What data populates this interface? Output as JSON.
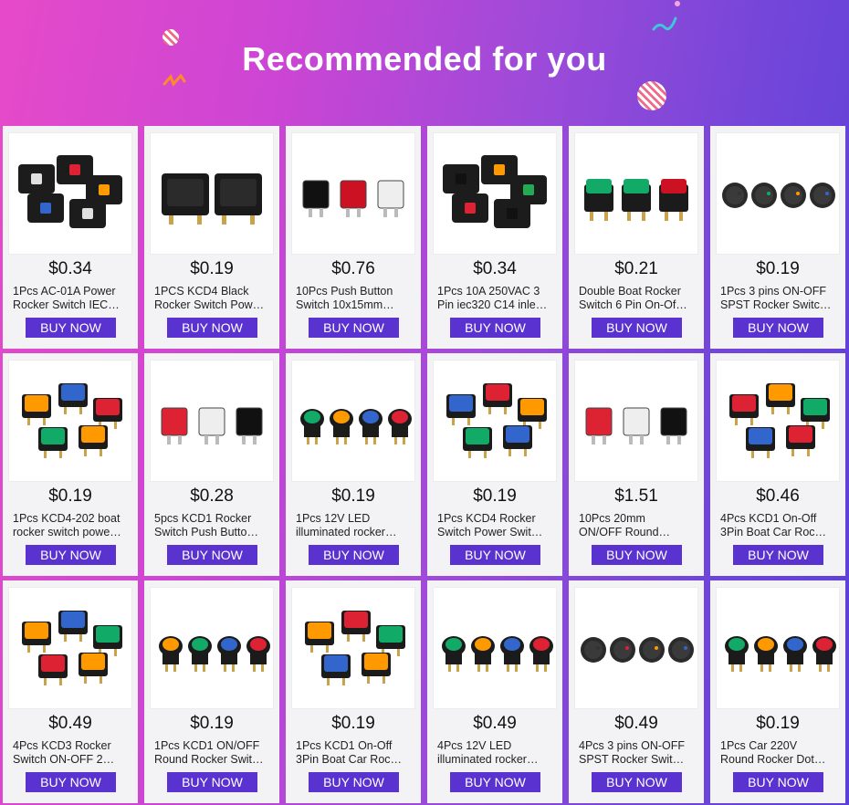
{
  "header": {
    "title": "Recommended for you",
    "accent_color": "#5a32d0"
  },
  "products": [
    {
      "price": "$0.34",
      "name_line1": "1Pcs AC-01A Power",
      "name_line2": "Rocker Switch IEC…",
      "button": "BUY NOW"
    },
    {
      "price": "$0.19",
      "name_line1": "1PCS KCD4 Black",
      "name_line2": "Rocker Switch Pow…",
      "button": "BUY NOW"
    },
    {
      "price": "$0.76",
      "name_line1": "10Pcs Push Button",
      "name_line2": "Switch 10x15mm…",
      "button": "BUY NOW"
    },
    {
      "price": "$0.34",
      "name_line1": "1Pcs 10A 250VAC 3",
      "name_line2": "Pin iec320 C14 inle…",
      "button": "BUY NOW"
    },
    {
      "price": "$0.21",
      "name_line1": "Double Boat Rocker",
      "name_line2": "Switch 6 Pin On-Of…",
      "button": "BUY NOW"
    },
    {
      "price": "$0.19",
      "name_line1": "1Pcs 3 pins ON-OFF",
      "name_line2": "SPST Rocker Switc…",
      "button": "BUY NOW"
    },
    {
      "price": "$0.19",
      "name_line1": "1Pcs KCD4-202 boat",
      "name_line2": "rocker switch powe…",
      "button": "BUY NOW"
    },
    {
      "price": "$0.28",
      "name_line1": "5pcs KCD1 Rocker",
      "name_line2": "Switch Push Butto…",
      "button": "BUY NOW"
    },
    {
      "price": "$0.19",
      "name_line1": "1Pcs 12V LED",
      "name_line2": "illuminated rocker…",
      "button": "BUY NOW"
    },
    {
      "price": "$0.19",
      "name_line1": "1Pcs KCD4 Rocker",
      "name_line2": "Switch Power Swit…",
      "button": "BUY NOW"
    },
    {
      "price": "$1.51",
      "name_line1": "10Pcs 20mm",
      "name_line2": "ON/OFF Round…",
      "button": "BUY NOW"
    },
    {
      "price": "$0.46",
      "name_line1": "4Pcs KCD1 On-Off",
      "name_line2": "3Pin Boat Car Roc…",
      "button": "BUY NOW"
    },
    {
      "price": "$0.49",
      "name_line1": "4Pcs KCD3 Rocker",
      "name_line2": "Switch ON-OFF 2…",
      "button": "BUY NOW"
    },
    {
      "price": "$0.19",
      "name_line1": "1Pcs KCD1 ON/OFF",
      "name_line2": "Round Rocker Swit…",
      "button": "BUY NOW"
    },
    {
      "price": "$0.19",
      "name_line1": "1Pcs KCD1 On-Off",
      "name_line2": "3Pin Boat Car Roc…",
      "button": "BUY NOW"
    },
    {
      "price": "$0.49",
      "name_line1": "4Pcs 12V LED",
      "name_line2": "illuminated rocker…",
      "button": "BUY NOW"
    },
    {
      "price": "$0.49",
      "name_line1": "4Pcs 3 pins ON-OFF",
      "name_line2": "SPST Rocker Swit…",
      "button": "BUY NOW"
    },
    {
      "price": "$0.19",
      "name_line1": "1Pcs Car 220V",
      "name_line2": "Round Rocker Dot…",
      "button": "BUY NOW"
    }
  ]
}
